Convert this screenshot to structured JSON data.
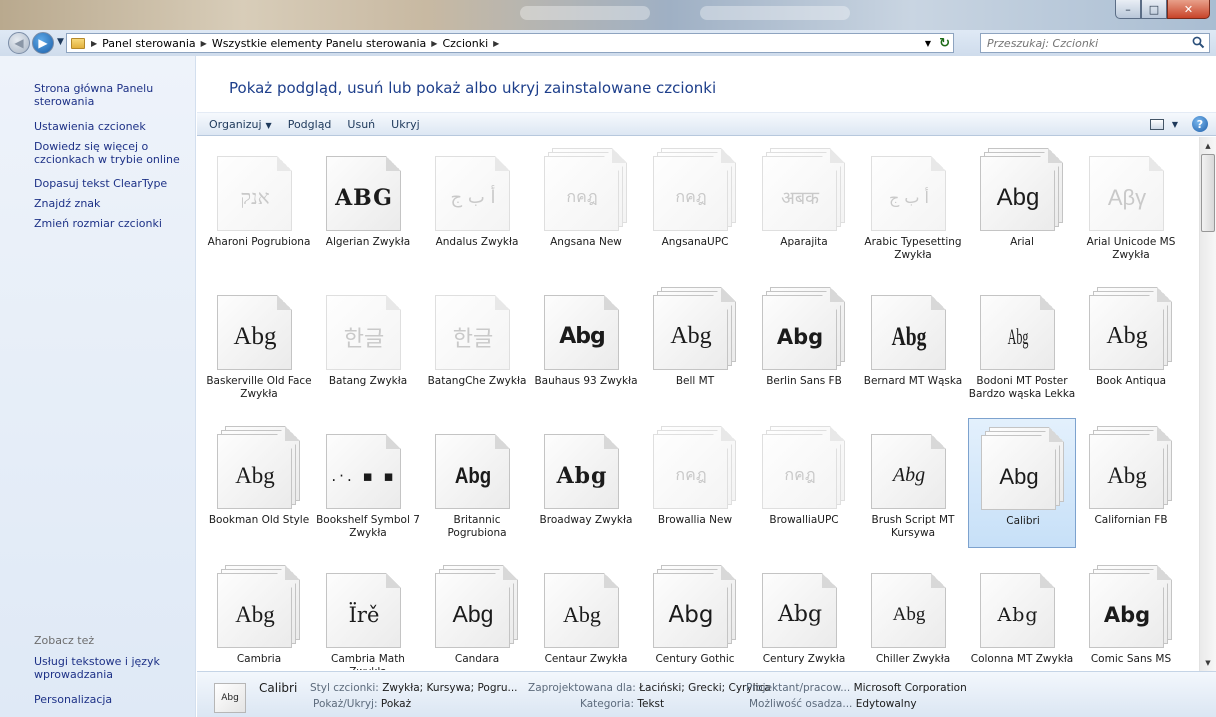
{
  "window": {
    "minimize": "–",
    "maximize": "□",
    "close": "✕"
  },
  "addressbar": {
    "crumbs": [
      "Panel sterowania",
      "Wszystkie elementy Panelu sterowania",
      "Czcionki"
    ],
    "search_placeholder": "Przeszukaj: Czcionki"
  },
  "leftpane": {
    "links": [
      "Strona główna Panelu sterowania",
      "Ustawienia czcionek",
      "Dowiedz się więcej o czcionkach w trybie online",
      "Dopasuj tekst ClearType",
      "Znajdź znak",
      "Zmień rozmiar czcionki"
    ],
    "see_also": "Zobacz też",
    "see_also_links": [
      "Usługi tekstowe i język wprowadzania",
      "Personalizacja"
    ]
  },
  "heading": "Pokaż podgląd, usuń lub pokaż albo ukryj zainstalowane czcionki",
  "toolbar": {
    "organize": "Organizuj",
    "preview": "Podgląd",
    "delete": "Usuń",
    "hide": "Ukryj",
    "help": "?"
  },
  "fonts": [
    {
      "name": "Aharoni Pogrubiona",
      "sample": "אנק",
      "stacked": false,
      "faded": true
    },
    {
      "name": "Algerian Zwykła",
      "sample": "ABG",
      "stacked": false,
      "faded": false
    },
    {
      "name": "Andalus Zwykła",
      "sample": "أ ب ج",
      "stacked": false,
      "faded": true
    },
    {
      "name": "Angsana New",
      "sample": "กคฎ",
      "stacked": true,
      "faded": true
    },
    {
      "name": "AngsanaUPC",
      "sample": "กคฎ",
      "stacked": true,
      "faded": true
    },
    {
      "name": "Aparajita",
      "sample": "अबक",
      "stacked": true,
      "faded": true
    },
    {
      "name": "Arabic Typesetting Zwykła",
      "sample": "أ ب ج",
      "stacked": false,
      "faded": true
    },
    {
      "name": "Arial",
      "sample": "Abg",
      "stacked": true,
      "faded": false
    },
    {
      "name": "Arial Unicode MS Zwykła",
      "sample": "Αβγ",
      "stacked": false,
      "faded": true
    },
    {
      "name": "Baskerville Old Face Zwykła",
      "sample": "Abg",
      "stacked": false,
      "faded": false
    },
    {
      "name": "Batang Zwykła",
      "sample": "한글",
      "stacked": false,
      "faded": true
    },
    {
      "name": "BatangChe Zwykła",
      "sample": "한글",
      "stacked": false,
      "faded": true
    },
    {
      "name": "Bauhaus 93 Zwykła",
      "sample": "Abg",
      "stacked": false,
      "faded": false
    },
    {
      "name": "Bell MT",
      "sample": "Abg",
      "stacked": true,
      "faded": false
    },
    {
      "name": "Berlin Sans FB",
      "sample": "Abg",
      "stacked": true,
      "faded": false
    },
    {
      "name": "Bernard MT Wąska",
      "sample": "Abg",
      "stacked": false,
      "faded": false
    },
    {
      "name": "Bodoni MT Poster Bardzo wąska Lekka",
      "sample": "Abg",
      "stacked": false,
      "faded": false
    },
    {
      "name": "Book Antiqua",
      "sample": "Abg",
      "stacked": true,
      "faded": false
    },
    {
      "name": "Bookman Old Style",
      "sample": "Abg",
      "stacked": true,
      "faded": false
    },
    {
      "name": "Bookshelf Symbol 7 Zwykła",
      "sample": ".·. ▪ ▪",
      "stacked": false,
      "faded": false
    },
    {
      "name": "Britannic Pogrubiona",
      "sample": "Abg",
      "stacked": false,
      "faded": false
    },
    {
      "name": "Broadway Zwykła",
      "sample": "Abg",
      "stacked": false,
      "faded": false
    },
    {
      "name": "Browallia New",
      "sample": "กคฎ",
      "stacked": true,
      "faded": true
    },
    {
      "name": "BrowalliaUPC",
      "sample": "กคฎ",
      "stacked": true,
      "faded": true
    },
    {
      "name": "Brush Script MT Kursywa",
      "sample": "Abg",
      "stacked": false,
      "faded": false
    },
    {
      "name": "Calibri",
      "sample": "Abg",
      "stacked": true,
      "faded": false,
      "selected": true
    },
    {
      "name": "Californian FB",
      "sample": "Abg",
      "stacked": true,
      "faded": false
    },
    {
      "name": "Cambria",
      "sample": "Abg",
      "stacked": true,
      "faded": false
    },
    {
      "name": "Cambria Math Zwykła",
      "sample": "Ïrě",
      "stacked": false,
      "faded": false
    },
    {
      "name": "Candara",
      "sample": "Abg",
      "stacked": true,
      "faded": false
    },
    {
      "name": "Centaur Zwykła",
      "sample": "Abg",
      "stacked": false,
      "faded": false
    },
    {
      "name": "Century Gothic",
      "sample": "Abg",
      "stacked": true,
      "faded": false
    },
    {
      "name": "Century Zwykła",
      "sample": "Abg",
      "stacked": false,
      "faded": false
    },
    {
      "name": "Chiller Zwykła",
      "sample": "Abg",
      "stacked": false,
      "faded": false
    },
    {
      "name": "Colonna MT Zwykła",
      "sample": "Abg",
      "stacked": false,
      "faded": false
    },
    {
      "name": "Comic Sans MS",
      "sample": "Abg",
      "stacked": true,
      "faded": false
    }
  ],
  "details": {
    "icon_label": "Abg",
    "name": "Calibri",
    "style_label": "Styl czcionki:",
    "style_value": "Zwykła; Kursywa; Pogru...",
    "designed_label": "Zaprojektowana dla:",
    "designed_value": "Łaciński; Grecki; Cyrylica",
    "designer_label": "Projektant/pracow...",
    "designer_value": "Microsoft Corporation",
    "showhide_label": "Pokaż/Ukryj:",
    "showhide_value": "Pokaż",
    "category_label": "Kategoria:",
    "category_value": "Tekst",
    "embed_label": "Możliwość osadza...",
    "embed_value": "Edytowalny"
  }
}
